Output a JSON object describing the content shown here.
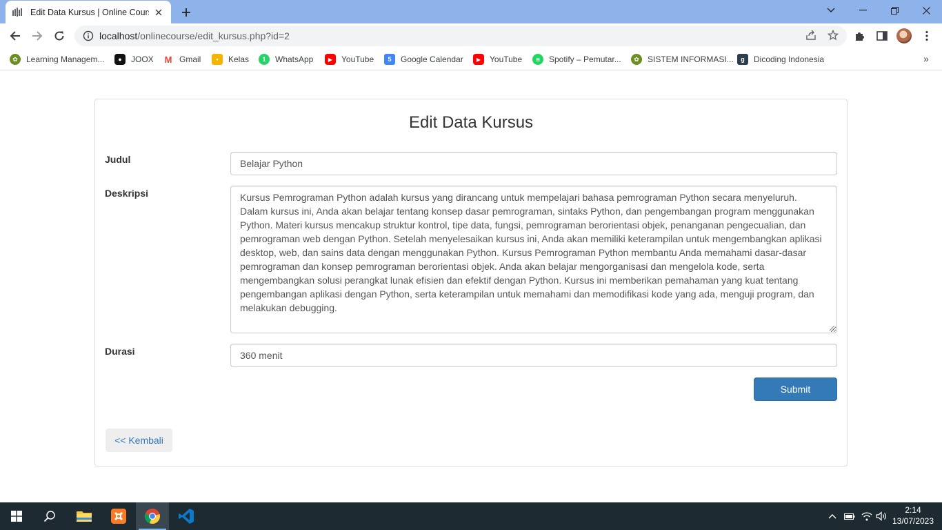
{
  "browser": {
    "tab_title": "Edit Data Kursus | Online Course",
    "url_host": "localhost",
    "url_path": "/onlinecourse/edit_kursus.php?id=2",
    "bookmarks": [
      {
        "label": "Learning Managem...",
        "icon": "university-emblem-icon",
        "color": "#6b8e23"
      },
      {
        "label": "JOOX",
        "icon": "joox-icon",
        "color": "#111111"
      },
      {
        "label": "Gmail",
        "icon": "gmail-icon",
        "color": "#ea4335"
      },
      {
        "label": "Kelas",
        "icon": "classroom-icon",
        "color": "#f4b400"
      },
      {
        "label": "WhatsApp",
        "icon": "whatsapp-icon",
        "color": "#25d366"
      },
      {
        "label": "YouTube",
        "icon": "youtube-icon",
        "color": "#ff0000"
      },
      {
        "label": "Google Calendar",
        "icon": "calendar-icon",
        "color": "#4285f4"
      },
      {
        "label": "YouTube",
        "icon": "youtube-icon",
        "color": "#ff0000"
      },
      {
        "label": "Spotify – Pemutar...",
        "icon": "spotify-icon",
        "color": "#1ed760"
      },
      {
        "label": "SISTEM INFORMASI...",
        "icon": "university-emblem-icon",
        "color": "#6b8e23"
      },
      {
        "label": "Dicoding Indonesia",
        "icon": "dicoding-icon",
        "color": "#2d3e50"
      }
    ],
    "more_label": "»"
  },
  "page": {
    "title": "Edit Data Kursus",
    "judul_label": "Judul",
    "judul_value": "Belajar Python",
    "deskripsi_label": "Deskripsi",
    "deskripsi_value": "Kursus Pemrograman Python adalah kursus yang dirancang untuk mempelajari bahasa pemrograman Python secara menyeluruh. Dalam kursus ini, Anda akan belajar tentang konsep dasar pemrograman, sintaks Python, dan pengembangan program menggunakan Python. Materi kursus mencakup struktur kontrol, tipe data, fungsi, pemrograman berorientasi objek, penanganan pengecualian, dan pemrograman web dengan Python. Setelah menyelesaikan kursus ini, Anda akan memiliki keterampilan untuk mengembangkan aplikasi desktop, web, dan sains data dengan menggunakan Python. Kursus Pemrograman Python membantu Anda memahami dasar-dasar pemrograman dan konsep pemrograman berorientasi objek. Anda akan belajar mengorganisasi dan mengelola kode, serta mengembangkan solusi perangkat lunak efisien dan efektif dengan Python. Kursus ini memberikan pemahaman yang kuat tentang pengembangan aplikasi dengan Python, serta keterampilan untuk memahami dan memodifikasi kode yang ada, menguji program, dan melakukan debugging.",
    "durasi_label": "Durasi",
    "durasi_value": "360 menit",
    "submit_label": "Submit",
    "back_label": "<< Kembali"
  },
  "taskbar": {
    "time": "2:14",
    "date": "13/07/2023",
    "apps": [
      "windows-start-icon",
      "search-icon",
      "file-explorer-icon",
      "xampp-icon",
      "chrome-icon",
      "vscode-icon"
    ]
  },
  "colors": {
    "tabbar": "#8db3ea",
    "primary": "#337ab7",
    "taskbar": "#1e2a32"
  }
}
